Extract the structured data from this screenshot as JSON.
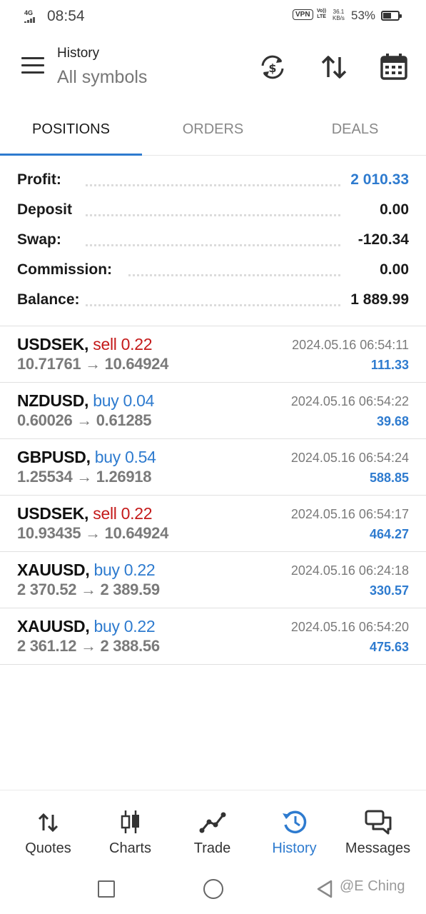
{
  "status_bar": {
    "network": "4G",
    "time": "08:54",
    "vpn": "VPN",
    "volte": "Vo)) LTE",
    "speed_value": "36.1",
    "speed_unit": "KB/s",
    "battery_pct": "53%",
    "battery_level": 0.53
  },
  "header": {
    "title": "History",
    "subtitle": "All symbols",
    "icons": [
      "currency-exchange-icon",
      "sort-icon",
      "calendar-icon"
    ]
  },
  "tabs": [
    {
      "label": "POSITIONS",
      "active": true
    },
    {
      "label": "ORDERS",
      "active": false
    },
    {
      "label": "DEALS",
      "active": false
    }
  ],
  "summary": [
    {
      "label": "Profit:",
      "value": "2 010.33",
      "highlight": true
    },
    {
      "label": "Deposit",
      "value": "0.00",
      "highlight": false
    },
    {
      "label": "Swap:",
      "value": "-120.34",
      "highlight": false
    },
    {
      "label": "Commission:",
      "value": "0.00",
      "highlight": false
    },
    {
      "label": "Balance:",
      "value": "1 889.99",
      "highlight": false
    }
  ],
  "deals": [
    {
      "symbol": "USDSEK,",
      "side": "sell 0.22",
      "type": "sell",
      "prices": "10.71761 → 10.64924",
      "time": "2024.05.16 06:54:11",
      "profit": "111.33"
    },
    {
      "symbol": "NZDUSD,",
      "side": "buy 0.04",
      "type": "buy",
      "prices": "0.60026 → 0.61285",
      "time": "2024.05.16 06:54:22",
      "profit": "39.68"
    },
    {
      "symbol": "GBPUSD,",
      "side": "buy 0.54",
      "type": "buy",
      "prices": "1.25534 → 1.26918",
      "time": "2024.05.16 06:54:24",
      "profit": "588.85"
    },
    {
      "symbol": "USDSEK,",
      "side": "sell 0.22",
      "type": "sell",
      "prices": "10.93435 → 10.64924",
      "time": "2024.05.16 06:54:17",
      "profit": "464.27"
    },
    {
      "symbol": "XAUUSD,",
      "side": "buy 0.22",
      "type": "buy",
      "prices": "2 370.52 → 2 389.59",
      "time": "2024.05.16 06:24:18",
      "profit": "330.57"
    },
    {
      "symbol": "XAUUSD,",
      "side": "buy 0.22",
      "type": "buy",
      "prices": "2 361.12 → 2 388.56",
      "time": "2024.05.16 06:54:20",
      "profit": "475.63"
    }
  ],
  "bottom_nav": [
    {
      "label": "Quotes",
      "icon": "quotes-arrows-icon",
      "active": false
    },
    {
      "label": "Charts",
      "icon": "candlestick-icon",
      "active": false
    },
    {
      "label": "Trade",
      "icon": "trade-line-icon",
      "active": false
    },
    {
      "label": "History",
      "icon": "history-clock-icon",
      "active": true
    },
    {
      "label": "Messages",
      "icon": "chat-bubbles-icon",
      "active": false
    }
  ],
  "watermark": "@E Ching",
  "colors": {
    "accent": "#2e7bcf",
    "sell": "#c41a1a",
    "muted": "#7a7a7a"
  }
}
